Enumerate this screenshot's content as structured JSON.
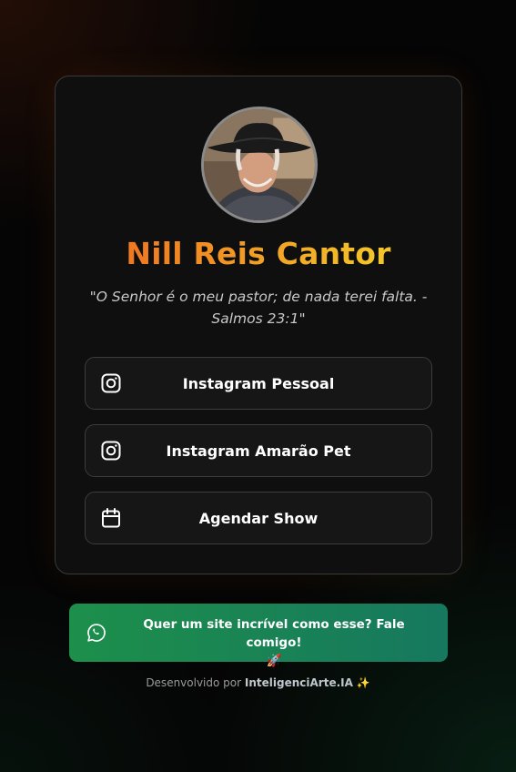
{
  "profile": {
    "name": "Nill Reis Cantor",
    "quote": "\"O Senhor é o meu pastor; de nada terei falta. - Salmos 23:1\"",
    "avatar_icon": "profile-photo"
  },
  "links": [
    {
      "label": "Instagram Pessoal",
      "icon": "instagram-icon"
    },
    {
      "label": "Instagram Amarão Pet",
      "icon": "instagram-icon"
    },
    {
      "label": "Agendar Show",
      "icon": "calendar-icon"
    }
  ],
  "cta": {
    "text": "Quer um site incrível como esse? Fale comigo!",
    "emoji": "🚀",
    "icon": "whatsapp-icon"
  },
  "footer": {
    "prefix": "Desenvolvido por",
    "brand": "InteligenciArte.IA",
    "sparkle": "✨"
  },
  "colors": {
    "name_gradient_start": "#f07a22",
    "name_gradient_end": "#f3c52a",
    "cta_start": "#1d8f4b",
    "cta_end": "#16785e"
  }
}
